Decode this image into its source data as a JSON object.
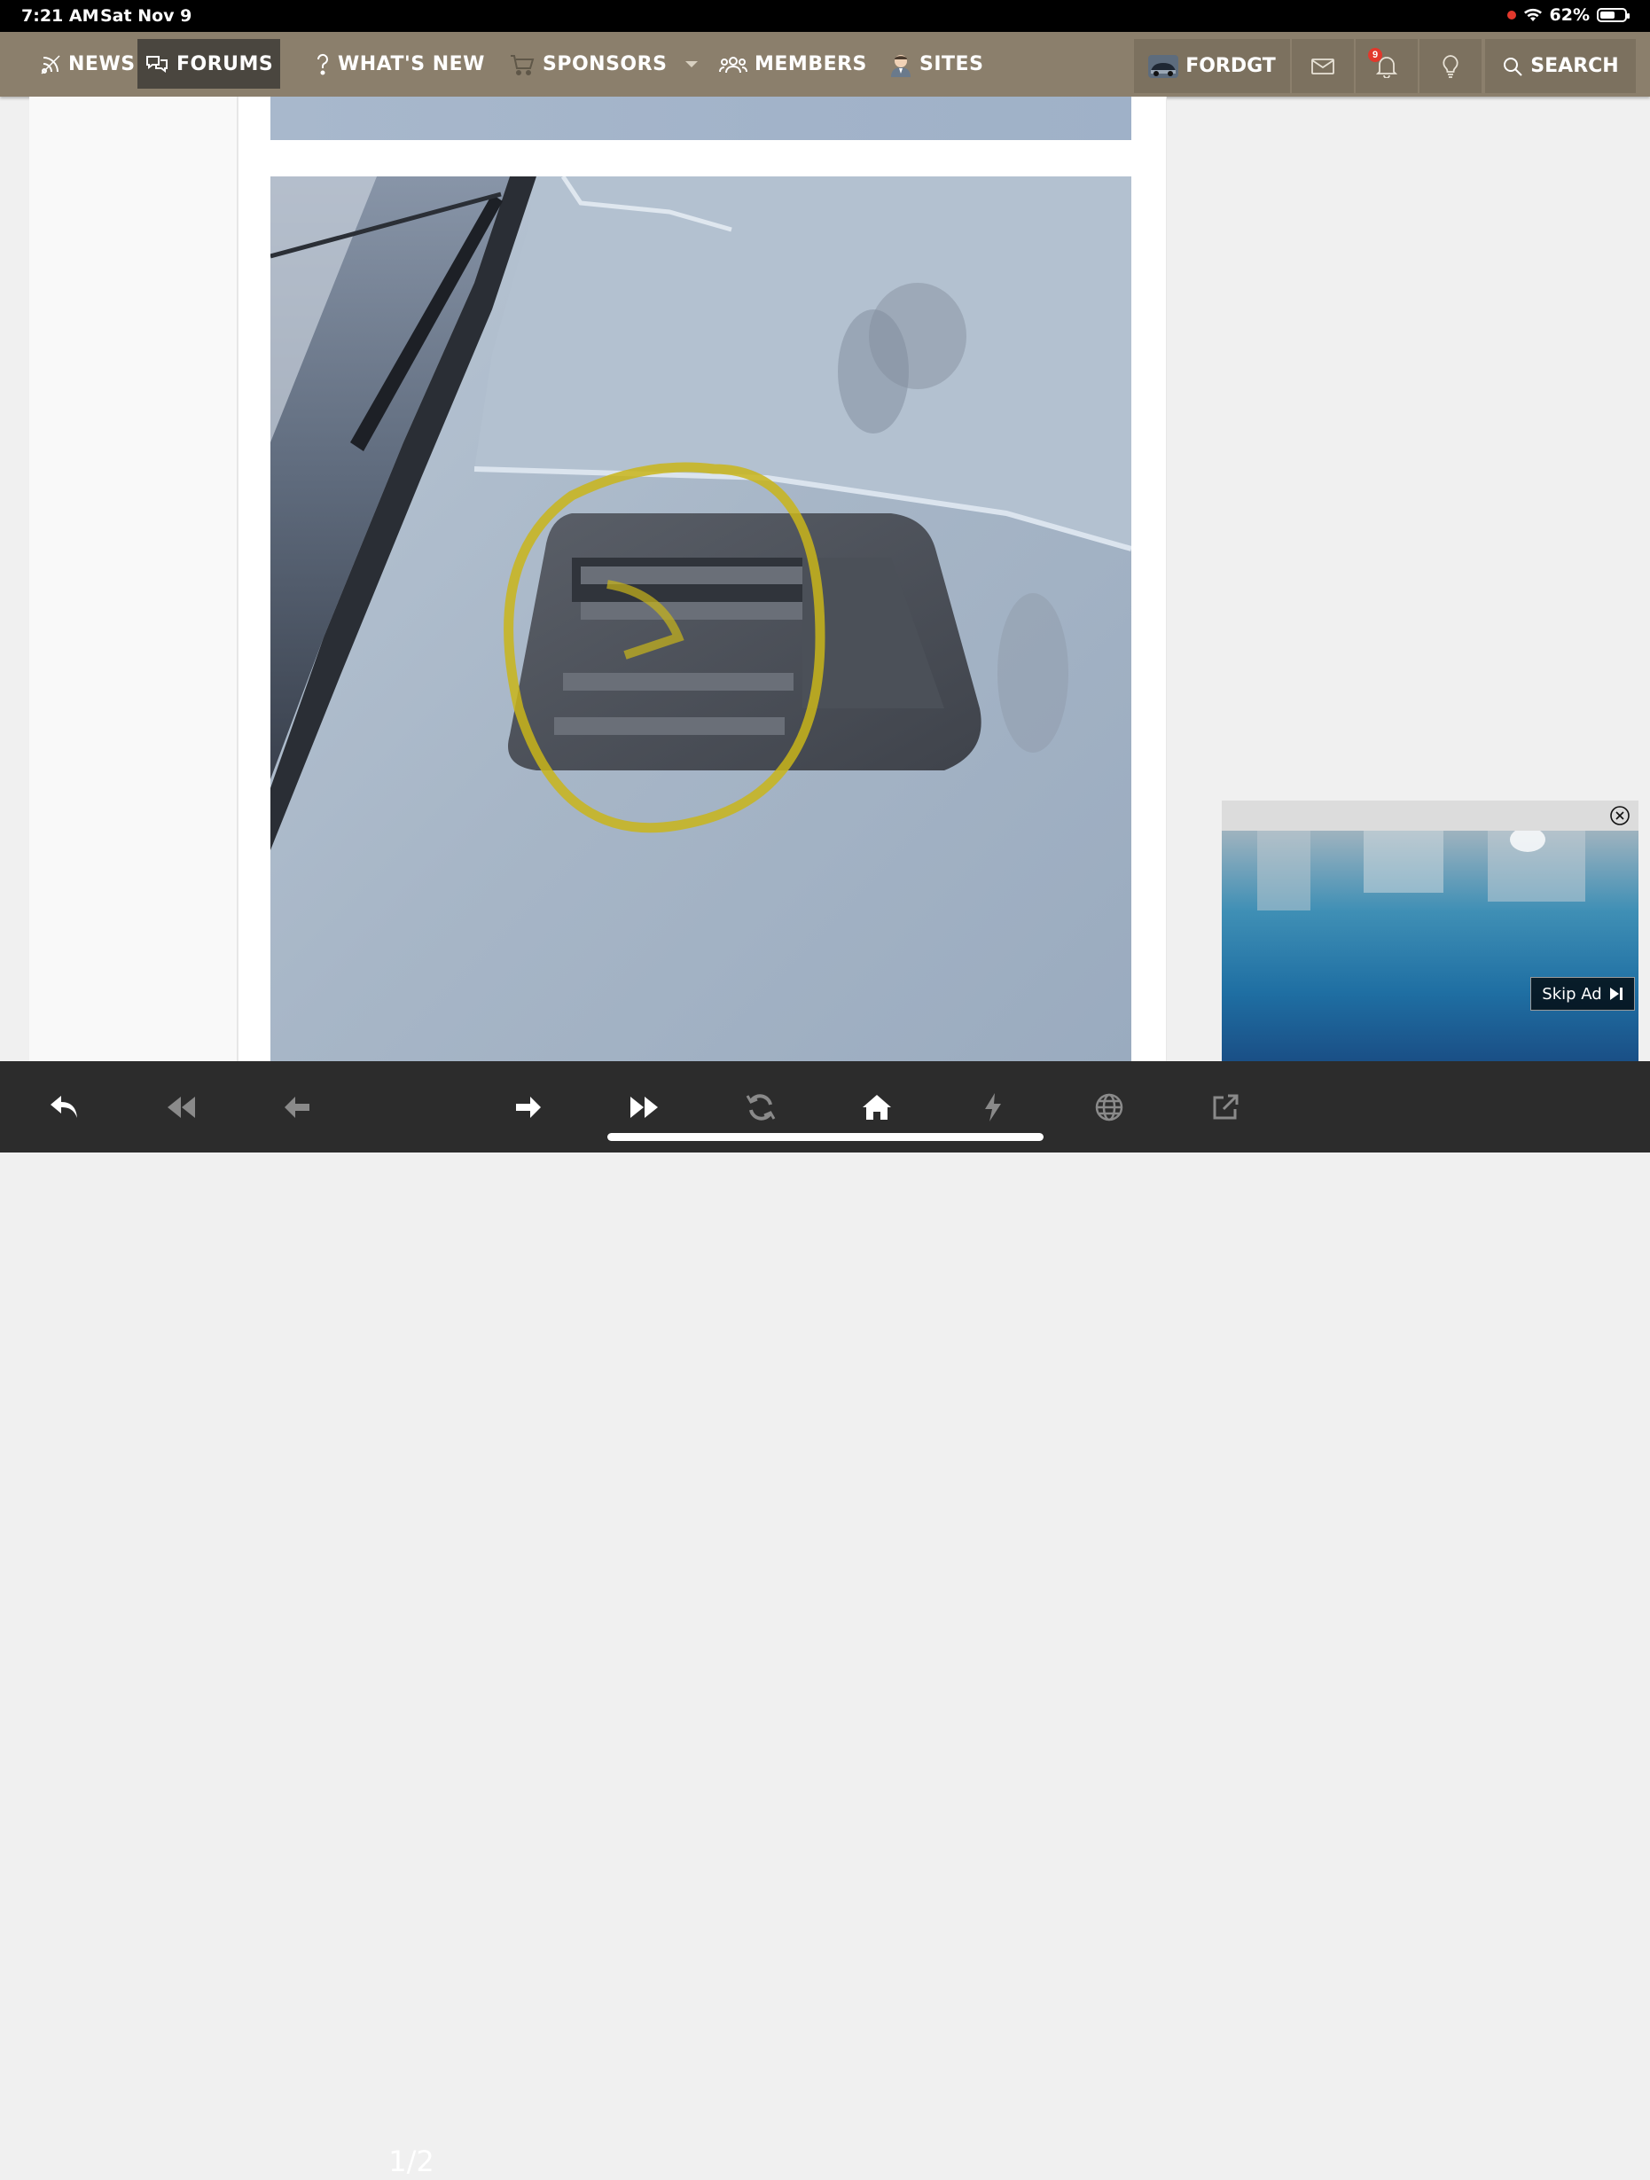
{
  "status_bar": {
    "time": "7:21 AM",
    "date": "Sat Nov 9",
    "battery": "62%",
    "battery_level": 0.62
  },
  "nav": {
    "news": "NEWS",
    "forums": "FORUMS",
    "whats_new": "WHAT'S NEW",
    "sponsors": "SPONSORS",
    "members": "MEMBERS",
    "sites": "SITES",
    "user": "FORDGT",
    "alerts_count": "9",
    "search": "SEARCH"
  },
  "ad": {
    "skip_label": "Skip Ad"
  },
  "toolbar": {
    "page": "1/2"
  },
  "colors": {
    "nav_bg": "#8b7f6c",
    "nav_active": "#4a463f",
    "toolbar_bg": "#2c2c2c",
    "highlight": "#c9b51a"
  },
  "icons": [
    "rss-icon",
    "chat-bubbles-icon",
    "question-icon",
    "cart-icon",
    "chevron-down-icon",
    "members-icon",
    "user-avatar-icon",
    "car-avatar-icon",
    "envelope-icon",
    "bell-icon",
    "lightbulb-icon",
    "search-icon",
    "close-icon",
    "skip-icon",
    "reply-icon",
    "rewind-icon",
    "arrow-left-icon",
    "arrow-right-icon",
    "fast-forward-icon",
    "refresh-icon",
    "home-icon",
    "lightning-icon",
    "globe-icon",
    "external-link-icon"
  ]
}
